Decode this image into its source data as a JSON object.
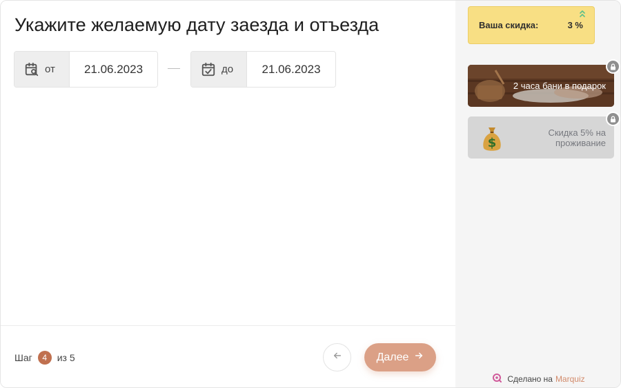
{
  "main": {
    "title": "Укажите желаемую дату заезда и отъезда",
    "date_from": {
      "label": "от",
      "value": "21.06.2023",
      "icon": "calendar-search-icon"
    },
    "date_to": {
      "label": "до",
      "value": "21.06.2023",
      "icon": "calendar-check-icon"
    }
  },
  "footer": {
    "step_prefix": "Шаг",
    "step_current": "4",
    "step_suffix": "из 5",
    "back_icon": "arrow-left-icon",
    "next_label": "Далее",
    "next_icon": "arrow-right-icon"
  },
  "sidebar": {
    "discount": {
      "label": "Ваша скидка:",
      "value": "3 %",
      "icon": "double-chevron-up-icon"
    },
    "bonuses": [
      {
        "text": "2 часа бани в подарок",
        "locked": true,
        "icon": "lock-icon"
      },
      {
        "text": "Скидка 5% на проживание",
        "locked": true,
        "icon": "lock-icon"
      }
    ],
    "made_by": {
      "prefix": "Сделано на",
      "brand": "Marquiz",
      "icon": "marquiz-logo-icon"
    }
  },
  "colors": {
    "accent": "#c0704f",
    "button": "#dba086",
    "discount_bg": "#f8df84",
    "sidebar_bg": "#f5f5f5",
    "brand": "#d28a6a"
  }
}
